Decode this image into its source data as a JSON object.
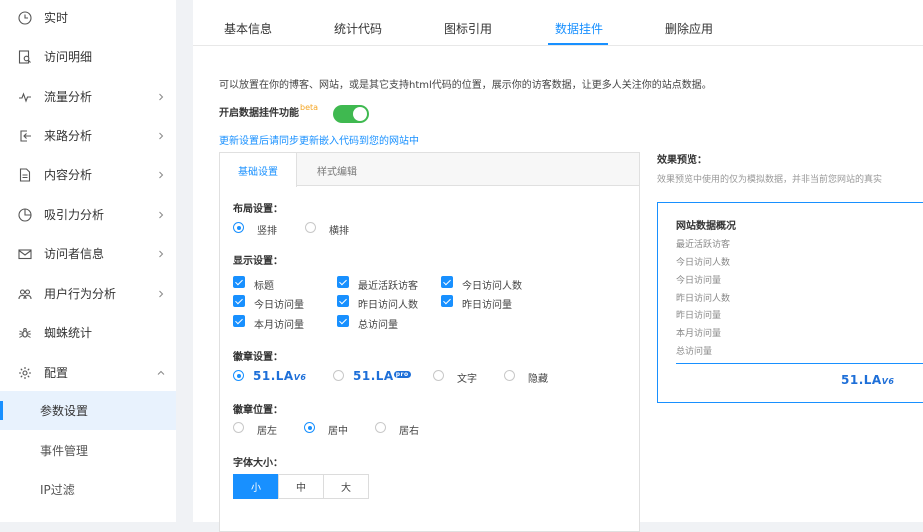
{
  "sidebar": {
    "items": [
      {
        "label": "实时"
      },
      {
        "label": "访问明细"
      },
      {
        "label": "流量分析"
      },
      {
        "label": "来路分析"
      },
      {
        "label": "内容分析"
      },
      {
        "label": "吸引力分析"
      },
      {
        "label": "访问者信息"
      },
      {
        "label": "用户行为分析"
      },
      {
        "label": "蜘蛛统计"
      },
      {
        "label": "配置"
      }
    ],
    "sub_items": [
      {
        "label": "参数设置"
      },
      {
        "label": "事件管理"
      },
      {
        "label": "IP过滤"
      }
    ]
  },
  "tabs": [
    "基本信息",
    "统计代码",
    "图标引用",
    "数据挂件",
    "删除应用"
  ],
  "description": "可以放置在你的博客、网站，或是其它支持html代码的位置，展示你的访客数据，让更多人关注你的站点数据。",
  "toggle": {
    "label": "开启数据挂件功能",
    "badge": "beta",
    "enabled": true
  },
  "update_link": "更新设置后请同步更新嵌入代码到您的网站中",
  "panel": {
    "tabs": [
      "基础设置",
      "样式编辑"
    ],
    "layout": {
      "title": "布局设置：",
      "options": [
        "竖排",
        "横排"
      ],
      "selected": "竖排"
    },
    "display": {
      "title": "显示设置：",
      "checkboxes": [
        "标题",
        "最近活跃访客",
        "今日访问人数",
        "今日访问量",
        "昨日访问人数",
        "昨日访问量",
        "本月访问量",
        "总访问量"
      ]
    },
    "badge": {
      "title": "徽章设置：",
      "logo1": "51.LA",
      "logo1_suffix": "V6",
      "logo2": "51.LA",
      "logo2_suffix": "pro",
      "text_option": "文字",
      "hide_option": "隐藏"
    },
    "badge_position": {
      "title": "徽章位置：",
      "options": [
        "居左",
        "居中",
        "居右"
      ],
      "selected": "居中"
    },
    "font_size": {
      "title": "字体大小：",
      "options": [
        "小",
        "中",
        "大"
      ],
      "selected": "小"
    }
  },
  "preview": {
    "title": "效果预览：",
    "desc": "效果预览中使用的仅为模拟数据，并非当前您网站的真实",
    "heading": "网站数据概况",
    "items": [
      "最近活跃访客",
      "今日访问人数",
      "今日访问量",
      "昨日访问人数",
      "昨日访问量",
      "本月访问量",
      "总访问量"
    ],
    "logo": "51.LA",
    "logo_suffix": "V6"
  },
  "colors": {
    "accent": "#1890ff",
    "switch_on": "#3fb950",
    "beta": "#f5a623"
  }
}
